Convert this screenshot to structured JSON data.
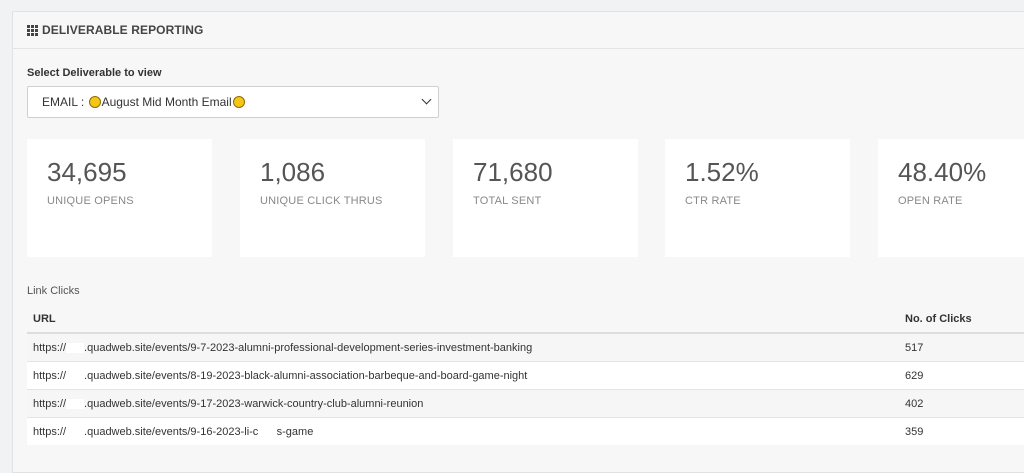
{
  "header": {
    "title": "DELIVERABLE REPORTING"
  },
  "select": {
    "label": "Select Deliverable to view",
    "prefix": "EMAIL : ",
    "value": "August Mid Month Email"
  },
  "stats": [
    {
      "value": "34,695",
      "label": "UNIQUE OPENS"
    },
    {
      "value": "1,086",
      "label": "UNIQUE CLICK THRUS"
    },
    {
      "value": "71,680",
      "label": "TOTAL SENT"
    },
    {
      "value": "1.52%",
      "label": "CTR RATE"
    },
    {
      "value": "48.40%",
      "label": "OPEN RATE"
    }
  ],
  "links": {
    "title": "Link Clicks",
    "columns": {
      "url": "URL",
      "clicks": "No. of Clicks"
    },
    "rows": [
      {
        "scheme": "https://",
        "url": ".quadweb.site/events/9-7-2023-alumni-professional-development-series-investment-banking",
        "clicks": "517"
      },
      {
        "scheme": "https://",
        "url": ".quadweb.site/events/8-19-2023-black-alumni-association-barbeque-and-board-game-night",
        "clicks": "629"
      },
      {
        "scheme": "https://",
        "url": ".quadweb.site/events/9-17-2023-warwick-country-club-alumni-reunion",
        "clicks": "402"
      },
      {
        "scheme": "https://",
        "url": ".quadweb.site/events/9-16-2023-li-c      s-game",
        "clicks": "359"
      }
    ]
  }
}
